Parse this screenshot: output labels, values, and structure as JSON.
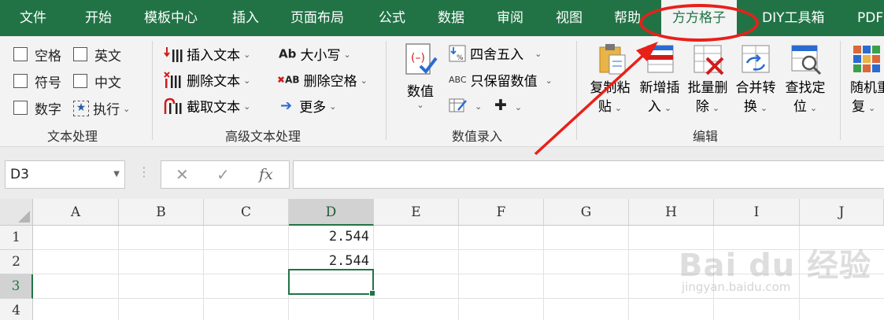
{
  "tabs": [
    {
      "label": "文件"
    },
    {
      "label": "开始"
    },
    {
      "label": "模板中心"
    },
    {
      "label": "插入"
    },
    {
      "label": "页面布局"
    },
    {
      "label": "公式"
    },
    {
      "label": "数据"
    },
    {
      "label": "审阅"
    },
    {
      "label": "视图"
    },
    {
      "label": "帮助"
    },
    {
      "label": "方方格子",
      "active": true
    },
    {
      "label": "DIY工具箱"
    },
    {
      "label": "PDF"
    }
  ],
  "ribbon": {
    "text_group": {
      "label": "文本处理",
      "checkboxes": [
        "空格",
        "英文",
        "符号",
        "中文",
        "数字"
      ],
      "execute": "执行"
    },
    "adv_text_group": {
      "label": "高级文本处理",
      "insert_text": "插入文本",
      "delete_text": "删除文本",
      "extract_text": "截取文本",
      "case": "大小写",
      "delete_space": "删除空格",
      "more": "更多"
    },
    "numeric_group": {
      "label": "数值录入",
      "value": "数值",
      "round": "四舍五入",
      "keep_numeric": "只保留数值"
    },
    "edit_group": {
      "label": "编辑",
      "copy_paste": [
        "复制粘",
        "贴"
      ],
      "insert_new": [
        "新增插",
        "入"
      ],
      "batch_delete": [
        "批量删",
        "除"
      ],
      "merge_convert": [
        "合并转",
        "换"
      ],
      "find_locate": [
        "查找定",
        "位"
      ],
      "random_repeat": [
        "随机重",
        "复"
      ]
    }
  },
  "formula_bar": {
    "name_box": "D3",
    "fx": "fx",
    "content": ""
  },
  "sheet": {
    "columns": [
      "A",
      "B",
      "C",
      "D",
      "E",
      "F",
      "G",
      "H",
      "I",
      "J"
    ],
    "rows": [
      "1",
      "2",
      "3",
      "4"
    ],
    "selected_cell": "D3",
    "cells": {
      "D1": "2.544",
      "D2": "2.544"
    }
  },
  "watermark": {
    "brand": "Bai du 经验",
    "url": "jingyan.baidu.com"
  },
  "colors": {
    "accent": "#217346",
    "highlight": "#e8201a"
  }
}
